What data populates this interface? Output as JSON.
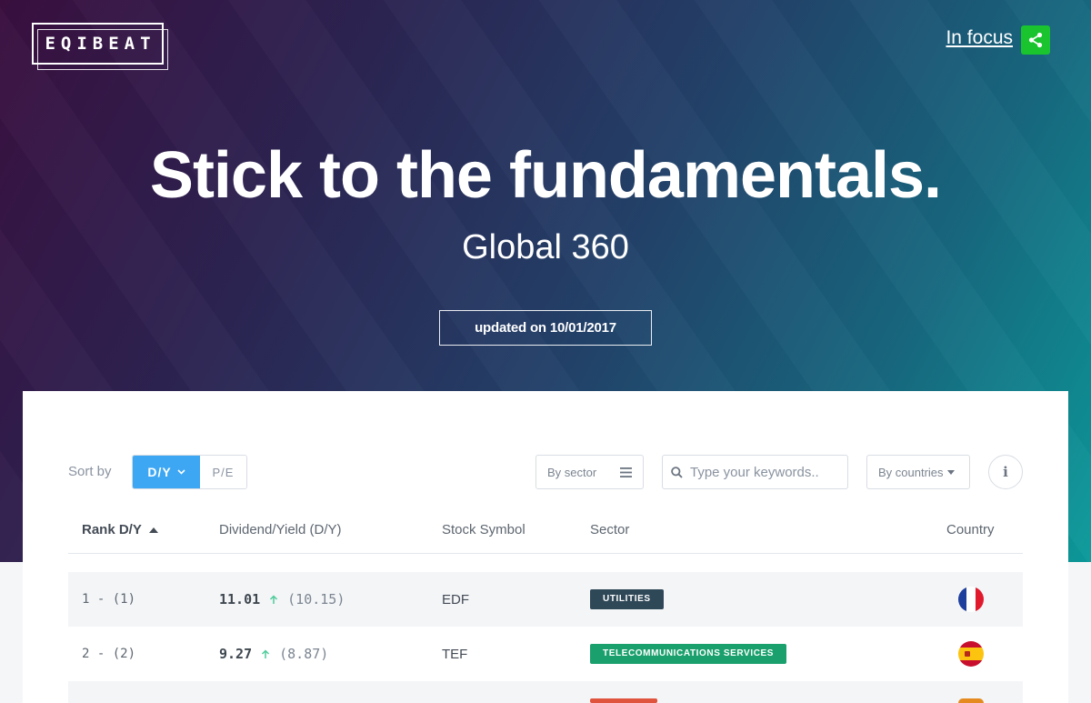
{
  "brand": {
    "logo_text": "EQIBEAT"
  },
  "header": {
    "in_focus_label": "In focus",
    "share_icon": "share-icon"
  },
  "hero": {
    "headline": "Stick to the fundamentals.",
    "subtitle": "Global 360",
    "updated_label": "updated on 10/01/2017"
  },
  "controls": {
    "sort_label": "Sort by",
    "sort_options": [
      "D/Y",
      "P/E"
    ],
    "sort_selected": "D/Y",
    "sector_filter_label": "By sector",
    "search_placeholder": "Type your keywords..",
    "countries_filter_label": "By countries",
    "info_label": "i"
  },
  "table": {
    "columns": [
      "Rank D/Y",
      "Dividend/Yield (D/Y)",
      "Stock Symbol",
      "Sector",
      "Country"
    ],
    "rows": [
      {
        "rank": "1 - (1)",
        "dy": "11.01",
        "dy_prev": "(10.15)",
        "trend": "up",
        "symbol": "EDF",
        "sector": "UTILITIES",
        "sector_color": "#2f4858",
        "country": "France"
      },
      {
        "rank": "2 - (2)",
        "dy": "9.27",
        "dy_prev": "(8.87)",
        "trend": "up",
        "symbol": "TEF",
        "sector": "TELECOMMUNICATIONS SERVICES",
        "sector_color": "#1aa06d",
        "country": "Spain"
      }
    ]
  },
  "colors": {
    "accent_blue": "#3ea7f3",
    "share_green": "#19c42f",
    "trend_up": "#4ecb9a"
  }
}
